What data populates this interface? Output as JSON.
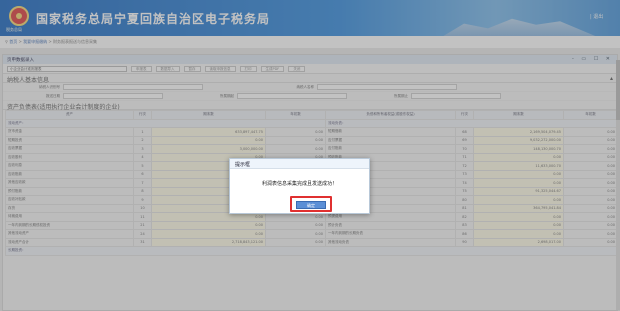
{
  "header": {
    "site_title": "国家税务总局宁夏回族自治区电子税务局",
    "logo_caption": "税务总局",
    "right_text": "|  退出"
  },
  "breadcrumb": {
    "home": "首页",
    "sep1": ">",
    "item1": "我要申报缴纳",
    "sep2": ">",
    "item2": "财务报表报送与信息采集"
  },
  "panel": {
    "title": "页申数据录入",
    "controls": "- ▭ ☐ ✕"
  },
  "toolbar": {
    "report_select": "小企业会计准则报表",
    "buttons": [
      "申报表",
      "数据导入",
      "暂存",
      "读取申报信息",
      "打印",
      "生成PDF",
      "关闭"
    ]
  },
  "sections": {
    "basic": "纳税人基本信息",
    "balance": "资产负债表(适用执行企业会计制度的企业)",
    "toggle": "▴"
  },
  "fields": {
    "taxpayer_id_label": "纳税人识别号",
    "taxpayer_name_label": "纳税人名称",
    "date_label": "报送日期",
    "period_start_label": "所属期起",
    "period_end_label": "所属期止"
  },
  "table": {
    "headers": [
      "资产",
      "行次",
      "期末数",
      "年初数",
      "负债和所有者权益(或股东权益)",
      "行次",
      "期末数",
      "年初数"
    ],
    "groups": {
      "left": "流动资产：",
      "right": "流动负债："
    },
    "rows": [
      {
        "a": "货币资金",
        "n": "1",
        "e": "633,897,447.75",
        "b": "0.00",
        "c": "短期借款",
        "m": "68",
        "f": "2,169,504,079.45",
        "g": "0.00"
      },
      {
        "a": "短期投资",
        "n": "2",
        "e": "0.00",
        "b": "0.00",
        "c": "应付票据",
        "m": "69",
        "f": "9,032,272,000.00",
        "g": "0.00"
      },
      {
        "a": "应收票据",
        "n": "3",
        "e": "3,000,000.00",
        "b": "0.00",
        "c": "应付账款",
        "m": "70",
        "f": "148,130,000.70",
        "g": "0.00"
      },
      {
        "a": "应收股利",
        "n": "4",
        "e": "0.00",
        "b": "0.00",
        "c": "预收账款",
        "m": "71",
        "f": "0.00",
        "g": "0.00"
      },
      {
        "a": "应收利息",
        "n": "5",
        "e": "0.00",
        "b": "0.00",
        "c": "应付工资",
        "m": "72",
        "f": "11,633,000.70",
        "g": "0.00"
      },
      {
        "a": "应收账款",
        "n": "6",
        "e": "45,200,040.00",
        "b": "0.00",
        "c": "应付福利费",
        "m": "73",
        "f": "0.00",
        "g": "0.00"
      },
      {
        "a": "其他应收款",
        "n": "7",
        "e": "1,277,190,249.17",
        "b": "0.00",
        "c": "应付股利",
        "m": "74",
        "f": "0.00",
        "g": "0.00"
      },
      {
        "a": "预付账款",
        "n": "8",
        "e": "0.00",
        "b": "0.00",
        "c": "应交税金",
        "m": "75",
        "f": "91,325,044.67",
        "g": "0.00"
      },
      {
        "a": "应收补贴款",
        "n": "9",
        "e": "0.00",
        "b": "0.00",
        "c": "其他应交款",
        "m": "80",
        "f": "0.00",
        "g": "0.00"
      },
      {
        "a": "存货",
        "n": "10",
        "e": "381,815,879.25",
        "b": "0.00",
        "c": "其他应付款",
        "m": "81",
        "f": "364,795,041.84",
        "g": "0.00"
      },
      {
        "a": "待摊费用",
        "n": "11",
        "e": "0.00",
        "b": "0.00",
        "c": "预提费用",
        "m": "82",
        "f": "0.00",
        "g": "0.00"
      },
      {
        "a": "一年内到期的长期债权投资",
        "n": "21",
        "e": "0.00",
        "b": "0.00",
        "c": "预计负债",
        "m": "83",
        "f": "0.00",
        "g": "0.00"
      },
      {
        "a": "其他流动资产",
        "n": "24",
        "e": "0.00",
        "b": "0.00",
        "c": "一年内到期的长期负债",
        "m": "86",
        "f": "0.00",
        "g": "0.00"
      },
      {
        "a": "流动资产合计",
        "n": "31",
        "e": "2,718,843,121.00",
        "b": "0.00",
        "c": "其他流动负债",
        "m": "90",
        "f": "2,698,017.00",
        "g": "0.00"
      }
    ],
    "footer_group": "长期投资："
  },
  "dialog": {
    "title": "提示框",
    "message": "利润表信息采集完成且发送成功！",
    "ok_label": "确定"
  }
}
